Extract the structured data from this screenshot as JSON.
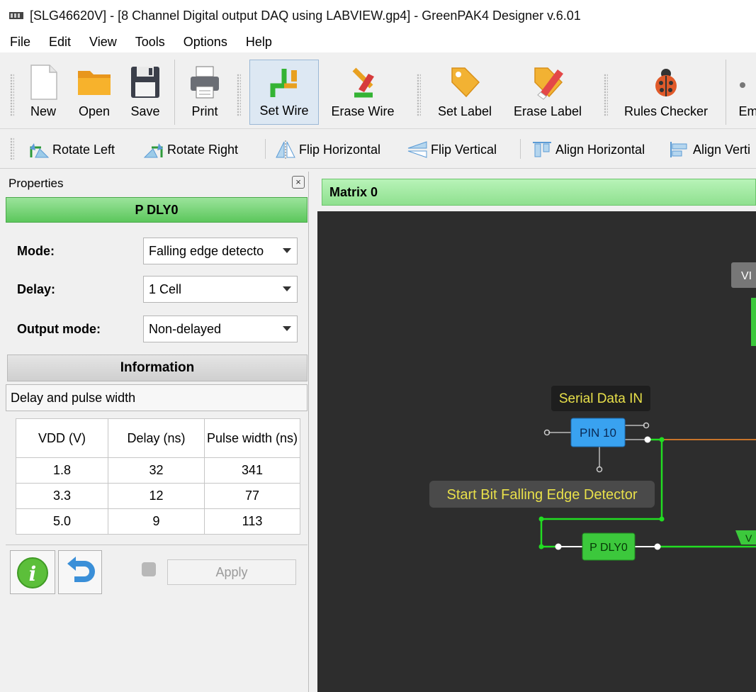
{
  "window": {
    "title": "[SLG46620V] - [8 Channel Digital output DAQ using LABVIEW.gp4] - GreenPAK4 Designer v.6.01"
  },
  "menu": [
    "File",
    "Edit",
    "View",
    "Tools",
    "Options",
    "Help"
  ],
  "toolbar": {
    "new": "New",
    "open": "Open",
    "save": "Save",
    "print": "Print",
    "set_wire": "Set Wire",
    "erase_wire": "Erase Wire",
    "set_label": "Set Label",
    "erase_label": "Erase Label",
    "rules_checker": "Rules Checker",
    "emulator": "Em"
  },
  "toolbar2": {
    "rotate_left": "Rotate Left",
    "rotate_right": "Rotate Right",
    "flip_horizontal": "Flip Horizontal",
    "flip_vertical": "Flip Vertical",
    "align_horizontal": "Align Horizontal",
    "align_vertical": "Align Verti"
  },
  "properties": {
    "header": "Properties",
    "block_name": "P DLY0",
    "mode_label": "Mode:",
    "mode_value": "Falling edge detecto",
    "delay_label": "Delay:",
    "delay_value": "1 Cell",
    "output_mode_label": "Output mode:",
    "output_mode_value": "Non-delayed",
    "info_header": "Information",
    "delay_pulse_label": "Delay and pulse width",
    "table": {
      "headers": [
        "VDD (V)",
        "Delay (ns)",
        "Pulse width (ns)"
      ],
      "rows": [
        [
          "1.8",
          "32",
          "341"
        ],
        [
          "3.3",
          "12",
          "77"
        ],
        [
          "5.0",
          "9",
          "113"
        ]
      ]
    },
    "apply_label": "Apply"
  },
  "canvas": {
    "matrix_title": "Matrix 0",
    "serial_label": "Serial Data IN",
    "pin_label": "PIN 10",
    "detector_label": "Start Bit Falling Edge Detector",
    "pdly_label": "P DLY0",
    "vdd_partial_1": "VI",
    "vdd_partial_2": "V"
  },
  "colors": {
    "wire_green": "#22dd22",
    "wire_orange": "#c8742a",
    "pin_blue": "#39a2f0",
    "block_green": "#3cc83c",
    "label_yellow": "#e8e04a",
    "canvas_bg": "#2d2d2d"
  }
}
